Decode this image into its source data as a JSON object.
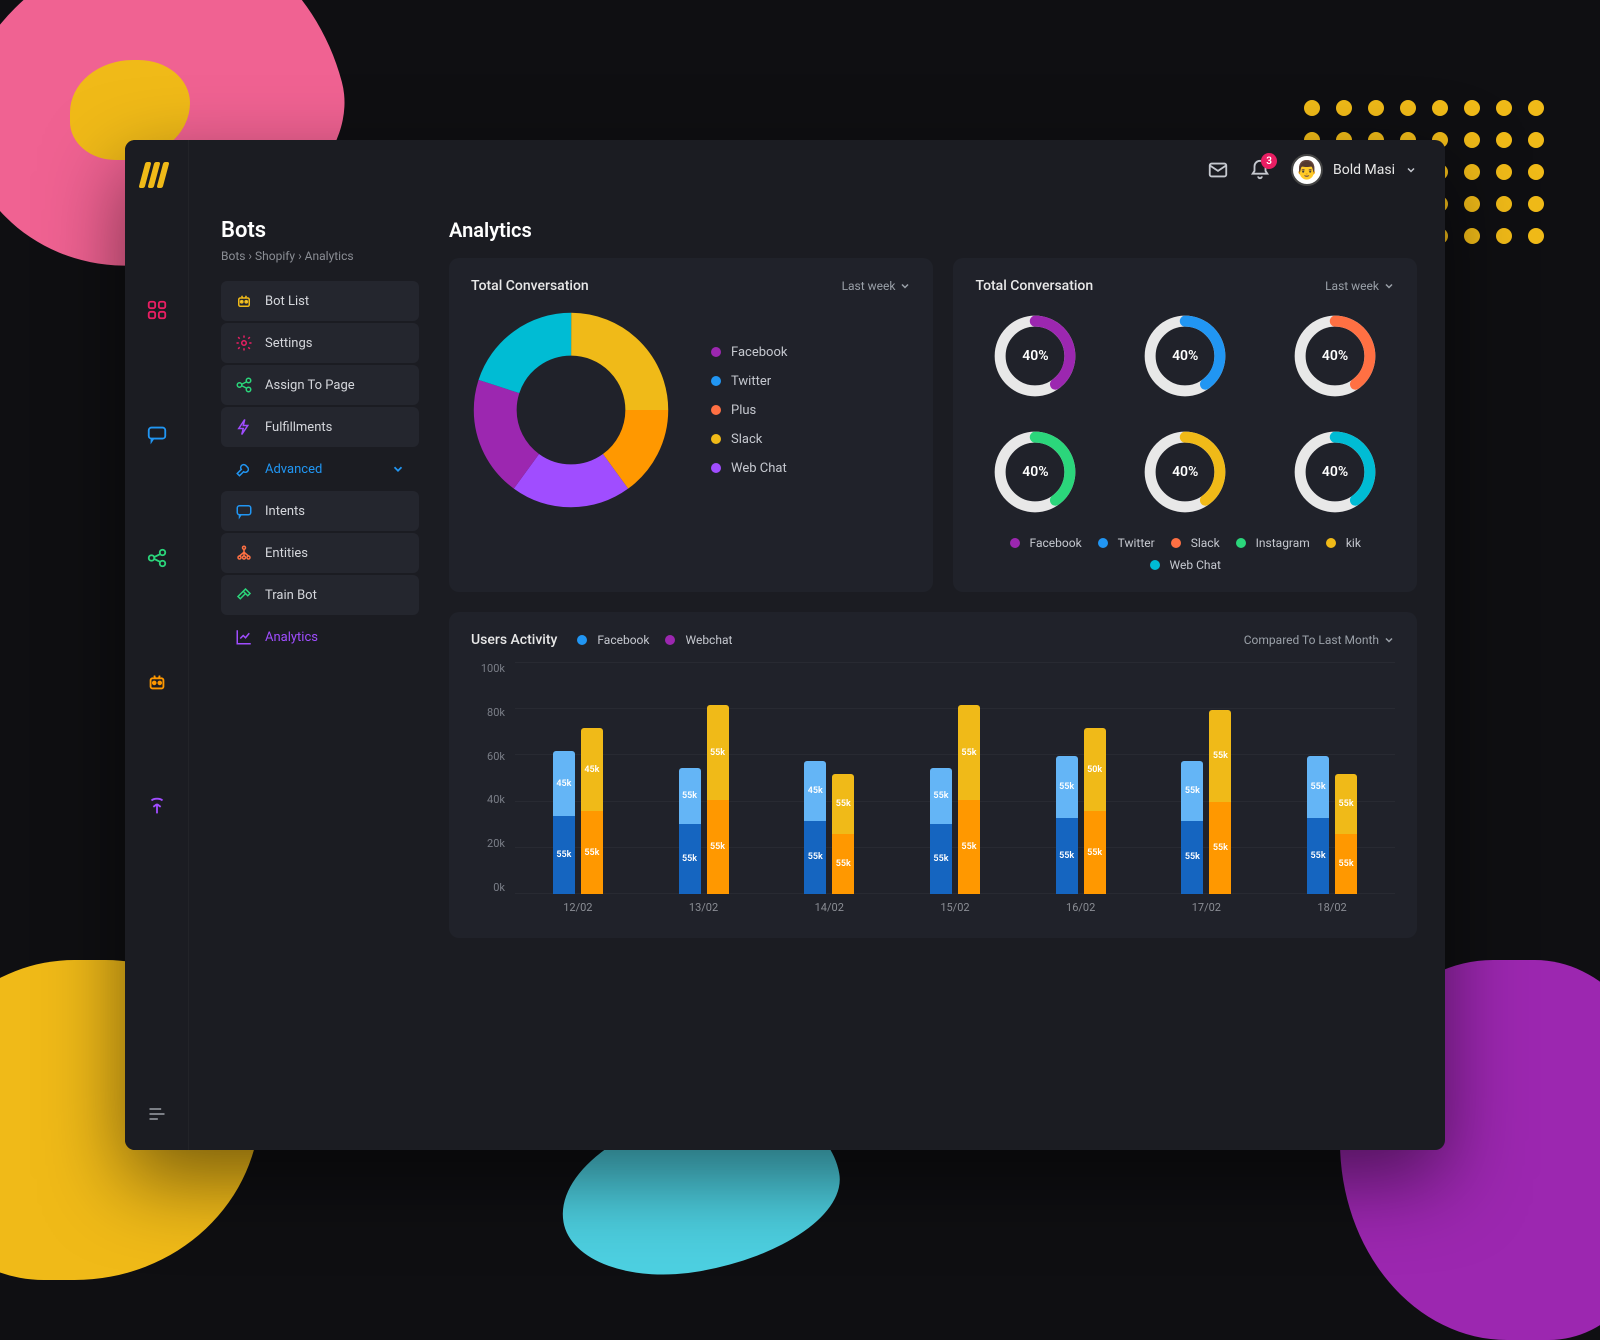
{
  "header": {
    "user_name": "Bold Masi",
    "notification_count": "3"
  },
  "page": {
    "title": "Bots",
    "breadcrumbs": [
      "Bots",
      "Shopify",
      "Analytics"
    ],
    "section_title": "Analytics"
  },
  "sidebar": {
    "items": [
      {
        "label": "Bot List",
        "icon": "robot",
        "color": "#f0ba18"
      },
      {
        "label": "Settings",
        "icon": "gear",
        "color": "#e91e63"
      },
      {
        "label": "Assign To Page",
        "icon": "share",
        "color": "#2bd67b"
      },
      {
        "label": "Fulfillments",
        "icon": "bolt",
        "color": "#a04dff"
      },
      {
        "label": "Advanced",
        "icon": "wrench",
        "color": "#2196f3",
        "expand": true
      },
      {
        "label": "Intents",
        "icon": "chat",
        "color": "#2196f3"
      },
      {
        "label": "Entities",
        "icon": "tree",
        "color": "#ff7043"
      },
      {
        "label": "Train Bot",
        "icon": "hammer",
        "color": "#2bd67b"
      },
      {
        "label": "Analytics",
        "icon": "chart",
        "color": "#a04dff",
        "active": true
      }
    ]
  },
  "cards": {
    "donut": {
      "title": "Total Conversation",
      "dropdown": "Last week"
    },
    "gauges": {
      "title": "Total Conversation",
      "dropdown": "Last week"
    },
    "activity": {
      "title": "Users Activity",
      "dropdown": "Compared To Last Month"
    }
  },
  "colors": {
    "purple": "#9c27b0",
    "blue": "#2196f3",
    "coral": "#ff7043",
    "yellow": "#f0ba18",
    "cyan": "#00bcd4",
    "orange": "#ff9800",
    "green": "#2bd67b",
    "magenta": "#e91e63",
    "lightblue": "#64b5f6",
    "deeporange": "#ff5722",
    "darkblue": "#1565c0"
  },
  "chart_data": [
    {
      "type": "pie",
      "title": "Total Conversation",
      "series": [
        {
          "name": "Facebook",
          "value": 20,
          "color": "#9c27b0"
        },
        {
          "name": "Twitter",
          "value": 20,
          "color": "#2196f3"
        },
        {
          "name": "Plus",
          "value": 15,
          "color": "#ff7043"
        },
        {
          "name": "Slack",
          "value": 25,
          "color": "#f0ba18"
        },
        {
          "name": "Web Chat",
          "value": 20,
          "color": "#a04dff"
        }
      ]
    },
    {
      "type": "gauge-grid",
      "title": "Total Conversation",
      "items": [
        {
          "name": "Facebook",
          "value": 40,
          "color": "#9c27b0"
        },
        {
          "name": "Twitter",
          "value": 40,
          "color": "#2196f3"
        },
        {
          "name": "Slack",
          "value": 40,
          "color": "#ff7043"
        },
        {
          "name": "Instagram",
          "value": 40,
          "color": "#2bd67b"
        },
        {
          "name": "kik",
          "value": 40,
          "color": "#f0ba18"
        },
        {
          "name": "Web Chat",
          "value": 40,
          "color": "#00bcd4"
        }
      ]
    },
    {
      "type": "bar",
      "title": "Users Activity",
      "ylabel": "",
      "ylim": [
        0,
        100
      ],
      "yticks": [
        "0k",
        "20k",
        "40k",
        "60k",
        "80k",
        "100k"
      ],
      "legend": [
        {
          "name": "Facebook",
          "color": "#2196f3"
        },
        {
          "name": "Webchat",
          "color": "#9c27b0"
        }
      ],
      "categories": [
        "12/02",
        "13/02",
        "14/02",
        "15/02",
        "16/02",
        "17/02",
        "18/02"
      ],
      "groups": [
        {
          "fb_top": 55,
          "fb_seg": 45,
          "wc_top": 55,
          "wc_seg": 45,
          "fb_total": 62,
          "wc_total": 72
        },
        {
          "fb_top": 55,
          "fb_seg": 55,
          "wc_top": 55,
          "wc_seg": 55,
          "fb_total": 55,
          "wc_total": 82
        },
        {
          "fb_top": 55,
          "fb_seg": 45,
          "wc_top": 55,
          "wc_seg": 55,
          "fb_total": 58,
          "wc_total": 52
        },
        {
          "fb_top": 55,
          "fb_seg": 55,
          "wc_top": 55,
          "wc_seg": 55,
          "fb_total": 55,
          "wc_total": 82
        },
        {
          "fb_top": 55,
          "fb_seg": 55,
          "wc_top": 55,
          "wc_seg": 50,
          "fb_total": 60,
          "wc_total": 72
        },
        {
          "fb_top": 55,
          "fb_seg": 55,
          "wc_top": 55,
          "wc_seg": 55,
          "fb_total": 58,
          "wc_total": 80
        },
        {
          "fb_top": 55,
          "fb_seg": 55,
          "wc_top": 55,
          "wc_seg": 55,
          "fb_total": 60,
          "wc_total": 52
        }
      ]
    }
  ]
}
